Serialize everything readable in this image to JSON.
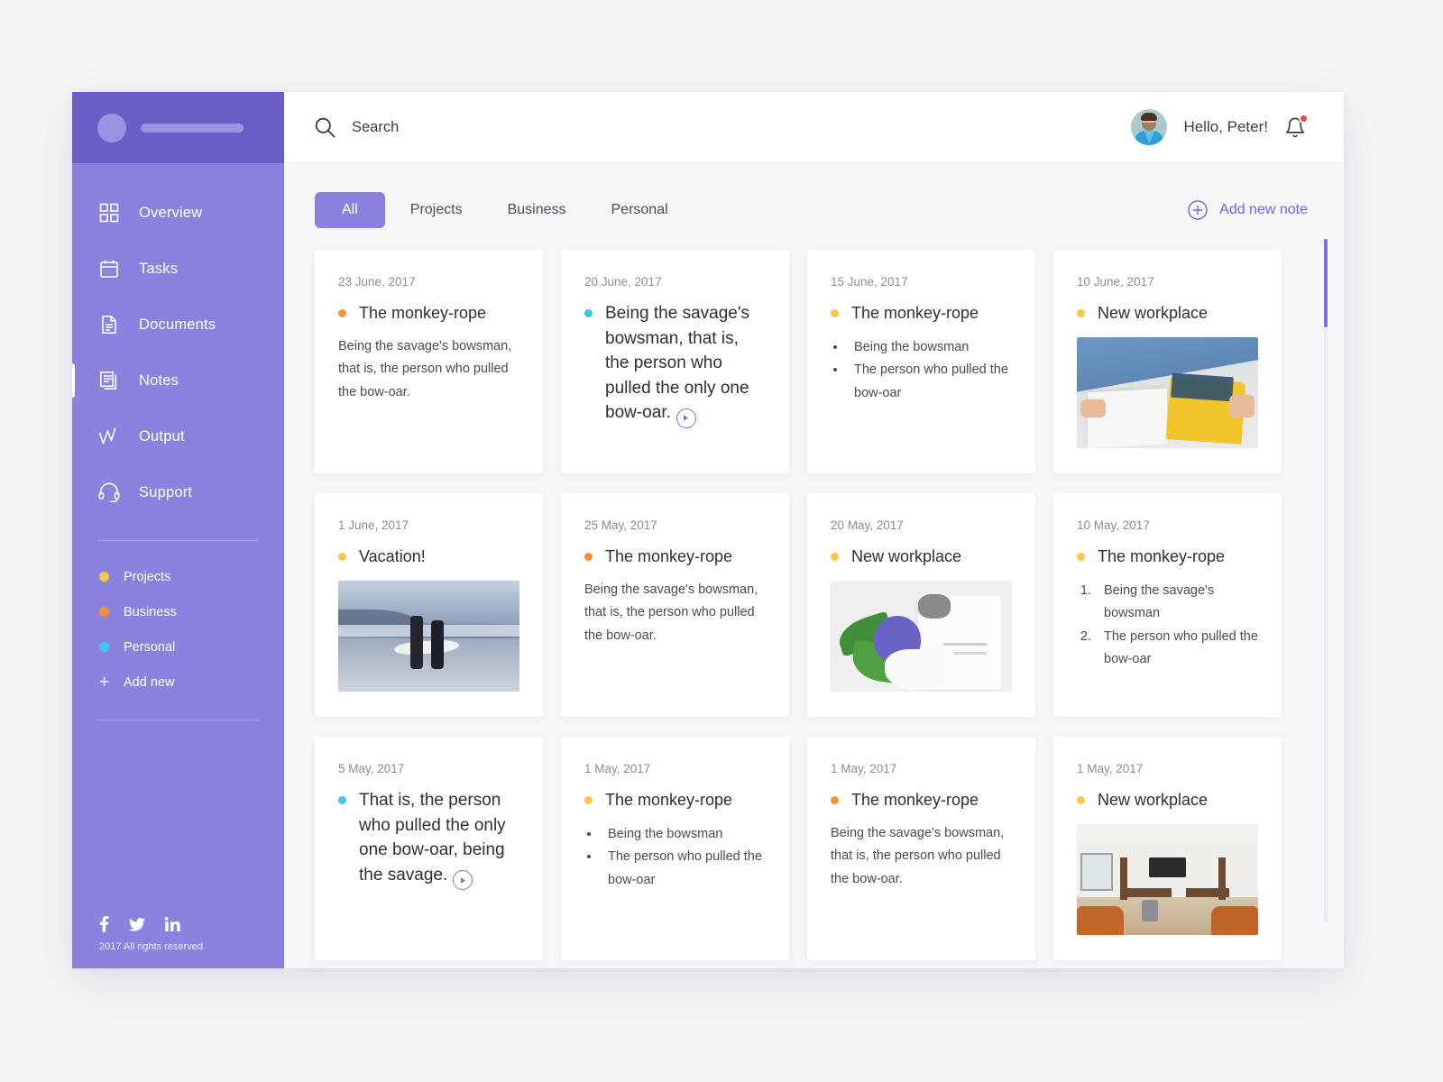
{
  "colors": {
    "brand_purple": "#8a82de",
    "brand_purple_dark": "#6a5ec7",
    "accent_link": "#6f63e0",
    "tag_projects": "#fbc54c",
    "tag_business": "#f7903d",
    "tag_personal": "#3ac8ef",
    "notification_red": "#f0464a"
  },
  "sidebar": {
    "logo": {
      "icon": "app-logo-placeholder"
    },
    "nav_items": [
      {
        "label": "Overview",
        "icon": "grid-icon",
        "active": false
      },
      {
        "label": "Tasks",
        "icon": "calendar-icon",
        "active": false
      },
      {
        "label": "Documents",
        "icon": "document-icon",
        "active": false
      },
      {
        "label": "Notes",
        "icon": "notes-icon",
        "active": true
      },
      {
        "label": "Output",
        "icon": "chart-line-icon",
        "active": false
      },
      {
        "label": "Support",
        "icon": "headset-icon",
        "active": false
      }
    ],
    "tags": [
      {
        "label": "Projects",
        "color": "#fbc54c"
      },
      {
        "label": "Business",
        "color": "#f7903d"
      },
      {
        "label": "Personal",
        "color": "#3ac8ef"
      }
    ],
    "add_new_label": "Add new",
    "socials": [
      "facebook-icon",
      "twitter-icon",
      "linkedin-icon"
    ],
    "copyright": "2017 All rights reserved"
  },
  "topbar": {
    "search_placeholder": "Search",
    "search_value": "",
    "greeting": "Hello, Peter!",
    "has_notification": true
  },
  "toolbar": {
    "tabs": [
      {
        "label": "All",
        "active": true
      },
      {
        "label": "Projects",
        "active": false
      },
      {
        "label": "Business",
        "active": false
      },
      {
        "label": "Personal",
        "active": false
      }
    ],
    "add_note_label": "Add new note"
  },
  "notes": [
    {
      "date": "23 June, 2017",
      "title": "The monkey-rope",
      "dot": "#f7903d",
      "type": "paragraph",
      "body": "Being the savage's bowsman, that is, the person who pulled the bow-oar.",
      "has_play": false
    },
    {
      "date": "20 June, 2017",
      "title": "Being the savage's bowsman, that is, the person who pulled the only one bow-oar.",
      "dot": "#3ac8ef",
      "type": "title-only",
      "body": "",
      "has_play": true
    },
    {
      "date": "15 June, 2017",
      "title": "The monkey-rope",
      "dot": "#fbc54c",
      "type": "bullets",
      "items": [
        "Being the bowsman",
        "The person who pulled the bow-oar"
      ],
      "has_play": false
    },
    {
      "date": "10 June, 2017",
      "title": "New workplace",
      "dot": "#fbc54c",
      "type": "image",
      "image": "person-reading-book-photo",
      "has_play": false
    },
    {
      "date": "1 June, 2017",
      "title": "Vacation!",
      "dot": "#fbc54c",
      "type": "image",
      "image": "surfers-on-beach-photo",
      "has_play": false
    },
    {
      "date": "25 May, 2017",
      "title": "The monkey-rope",
      "dot": "#f7903d",
      "type": "paragraph",
      "body": "Being the savage's bowsman, that is, the person who pulled the bow-oar.",
      "has_play": false
    },
    {
      "date": "20 May, 2017",
      "title": "New workplace",
      "dot": "#fbc54c",
      "type": "image",
      "image": "flower-and-package-photo",
      "has_play": false
    },
    {
      "date": "10 May, 2017",
      "title": "The monkey-rope",
      "dot": "#fbc54c",
      "type": "numbered",
      "items": [
        "Being the savage's bowsman",
        "The person who pulled the bow-oar"
      ],
      "has_play": false
    },
    {
      "date": "5 May, 2017",
      "title": "That is, the person who pulled the only one bow-oar, being the savage.",
      "dot": "#3ac8ef",
      "type": "title-only",
      "body": "",
      "has_play": true
    },
    {
      "date": "1 May, 2017",
      "title": "The monkey-rope",
      "dot": "#fbc54c",
      "type": "bullets",
      "items": [
        "Being the bowsman",
        "The person who pulled the bow-oar"
      ],
      "has_play": false
    },
    {
      "date": "1 May, 2017",
      "title": "The monkey-rope",
      "dot": "#f7903d",
      "type": "paragraph",
      "body": "Being the savage's bowsman, that is, the person who pulled the bow-oar.",
      "has_play": false
    },
    {
      "date": "1 May, 2017",
      "title": "New workplace",
      "dot": "#fbc54c",
      "type": "image",
      "image": "office-lounge-photo",
      "has_play": false
    }
  ]
}
